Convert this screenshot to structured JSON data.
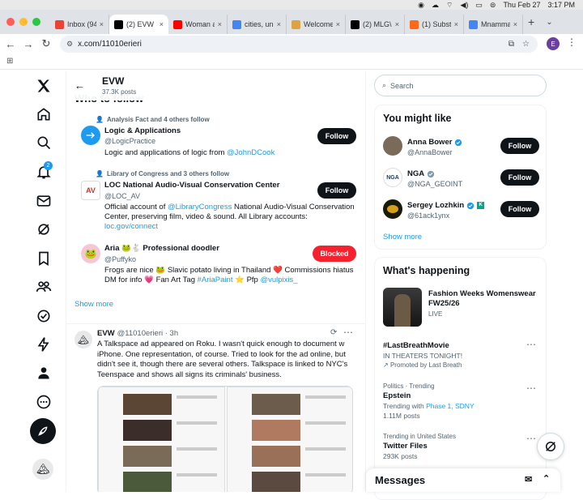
{
  "menubar": {
    "date": "Thu Feb 27",
    "time": "3:17 PM"
  },
  "tabs": [
    {
      "label": "Inbox (94",
      "icon": "gmail-icon",
      "color": "#ea4335",
      "active": false
    },
    {
      "label": "(2) EVW",
      "icon": "x-logo-icon",
      "color": "#000000",
      "active": true
    },
    {
      "label": "Woman a",
      "icon": "youtube-icon",
      "color": "#ff0000",
      "active": false
    },
    {
      "label": "cities, un",
      "icon": "google-icon",
      "color": "#4285f4",
      "active": false
    },
    {
      "label": "Welcome",
      "icon": "welcome-icon",
      "color": "#d9a441",
      "active": false
    },
    {
      "label": "(2) MLG\\",
      "icon": "x-logo-icon",
      "color": "#000000",
      "active": false
    },
    {
      "label": "(1) Subst",
      "icon": "substack-icon",
      "color": "#ff6719",
      "active": false
    },
    {
      "label": "Mnamma",
      "icon": "google-icon",
      "color": "#4285f4",
      "active": false
    }
  ],
  "omnibox": {
    "url": "x.com/11010erieri"
  },
  "profile_initial": "E",
  "header": {
    "name": "EVW",
    "posts": "37.3K posts"
  },
  "who_to_follow": {
    "title": "Who to follow",
    "accounts": [
      {
        "context": "Analysis Fact and 4 others follow",
        "name": "Logic & Applications",
        "handle": "@LogicPractice",
        "bio_text": "Logic and applications of logic from ",
        "bio_link": "@JohnDCook",
        "button": "Follow"
      },
      {
        "context": "Library of Congress and 3 others follow",
        "name": "LOC National Audio-Visual Conservation Center",
        "handle": "@LOC_AV",
        "bio_pre": "Official account of ",
        "bio_link": "@LibraryCongress",
        "bio_post": " National Audio-Visual Conservation Center, preserving film, video & sound. All Library accounts:",
        "bio_link2": "loc.gov/connect",
        "button": "Follow"
      },
      {
        "name": "Aria 🐸🐇 Professional doodler",
        "handle": "@Puffyko",
        "bio_line1": "Frogs are nice 🐸 Slavic potato living in Thailand ❤️ Commissions hiatus",
        "bio_line2_pre": "DM for info 💗 Fan Art Tag ",
        "bio_tag": "#AriaPaint",
        "bio_mid": " ⭐ Pfp ",
        "bio_link": "@vulpixis_",
        "button": "Blocked"
      }
    ],
    "show_more": "Show more"
  },
  "post": {
    "name": "EVW",
    "handle_time": "@11010erieri · 3h",
    "text": "A Talkspace ad appeared on Roku. I wasn't quick enough to document w iPhone. One representation, of course. Tried to look for the ad online, but didn't see it, though there are several others. Talkspace is linked to NYC's Teenspace and shows all signs its criminals' business."
  },
  "search": {
    "placeholder": "Search"
  },
  "you_might_like": {
    "title": "You might like",
    "accounts": [
      {
        "name": "Anna Bower",
        "handle": "@AnnaBower",
        "button": "Follow"
      },
      {
        "name": "NGA",
        "handle": "@NGA_GEOINT",
        "button": "Follow"
      },
      {
        "name": "Sergey Lozhkin",
        "handle": "@61ack1ynx",
        "button": "Follow"
      }
    ],
    "show_more": "Show more"
  },
  "whats_happening": {
    "title": "What's happening",
    "featured": {
      "title": "Fashion Weeks Womenswear FW25/26",
      "status": "LIVE"
    },
    "promoted": {
      "title": "#LastBreathMovie",
      "sub": "IN THEATERS TONIGHT!",
      "promoted_by": "Promoted by Last Breath"
    },
    "trends": [
      {
        "meta": "Politics · Trending",
        "title": "Epstein",
        "sub_pre": "Trending with ",
        "sub_links": "Phase 1, SDNY",
        "count": "1.11M posts"
      },
      {
        "meta": "Trending in United States",
        "title": "Twitter Files",
        "count": "293K posts"
      }
    ]
  },
  "messages": {
    "title": "Messages"
  },
  "colors": {
    "accent": "#1d9bf0",
    "dark": "#0f1419",
    "blocked": "#f4212e",
    "muted": "#536471"
  }
}
